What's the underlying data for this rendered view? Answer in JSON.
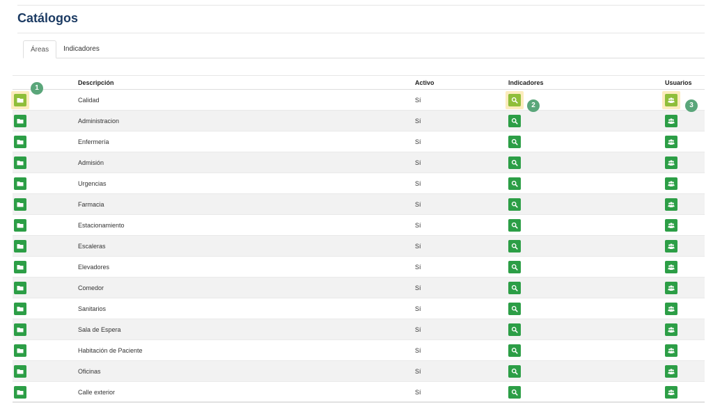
{
  "page": {
    "title": "Catálogos"
  },
  "tabs": [
    {
      "label": "Áreas",
      "active": true
    },
    {
      "label": "Indicadores",
      "active": false
    }
  ],
  "table": {
    "headers": {
      "folder": "",
      "description": "Descripción",
      "active": "Activo",
      "indicators": "Indicadores",
      "users": "Usuarios"
    },
    "rows": [
      {
        "description": "Calidad",
        "active": "Sí"
      },
      {
        "description": "Administracion",
        "active": "Sí"
      },
      {
        "description": "Enfermería",
        "active": "Sí"
      },
      {
        "description": "Admisión",
        "active": "Sí"
      },
      {
        "description": "Urgencias",
        "active": "Sí"
      },
      {
        "description": "Farmacia",
        "active": "Sí"
      },
      {
        "description": "Estacionamiento",
        "active": "Sí"
      },
      {
        "description": "Escaleras",
        "active": "Sí"
      },
      {
        "description": "Elevadores",
        "active": "Sí"
      },
      {
        "description": "Comedor",
        "active": "Sí"
      },
      {
        "description": "Sanitarios",
        "active": "Sí"
      },
      {
        "description": "Sala de Espera",
        "active": "Sí"
      },
      {
        "description": "Habitación de Paciente",
        "active": "Sí"
      },
      {
        "description": "Oficinas",
        "active": "Sí"
      },
      {
        "description": "Calle exterior",
        "active": "Sí"
      }
    ]
  },
  "markers": [
    "1",
    "2",
    "3"
  ],
  "icons": {
    "folder": "folder-icon",
    "indicators": "search-icon",
    "users": "users-icon"
  },
  "colors": {
    "button_green": "#2c9e46",
    "highlight_green": "#8fbe3a",
    "highlight_bg": "#fce9b2",
    "marker": "#5aa67a",
    "title": "#1c3b63"
  }
}
